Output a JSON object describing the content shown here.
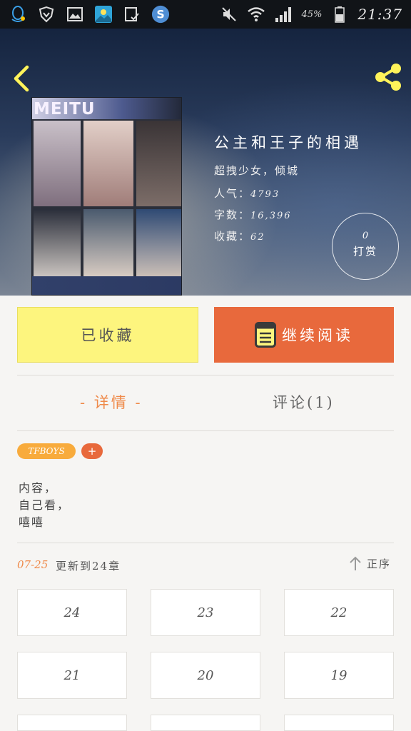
{
  "status_bar": {
    "battery_percent": "45%",
    "time": "21:37",
    "left_icons": [
      "qq-icon",
      "shield-icon",
      "gallery-icon",
      "scenery-app-icon",
      "check-icon",
      "s-app-icon"
    ],
    "right_icons": [
      "mute-icon",
      "wifi-icon",
      "signal-icon",
      "battery-icon"
    ]
  },
  "header": {
    "book_title": "公主和王子的相遇",
    "author": "超拽少女，倾城",
    "popularity": {
      "label": "人气：",
      "value": "4793"
    },
    "words": {
      "label": "字数：",
      "value": "16,396"
    },
    "favorites": {
      "label": "收藏：",
      "value": "62"
    },
    "reward": {
      "count": "0",
      "label": "打赏"
    },
    "cover_word": "MEITU"
  },
  "actions": {
    "collected_label": "已收藏",
    "continue_label": "继续阅读"
  },
  "tabs": {
    "details_label": "- 详情 -",
    "comments_label": "评论(1)"
  },
  "tags": {
    "items": [
      "TFBOYS"
    ],
    "add_label": "+"
  },
  "description": {
    "lines": [
      "内容，",
      "自己看，",
      "嘻嘻"
    ]
  },
  "update": {
    "date": "07-25",
    "text": "更新到24章",
    "sort_label": "正序"
  },
  "chapters": [
    "24",
    "23",
    "22",
    "21",
    "20",
    "19",
    "",
    "",
    ""
  ],
  "colors": {
    "accent_orange": "#e8693c",
    "collected_yellow": "#fdf57e",
    "tag_orange": "#f8ab3c",
    "tab_active": "#ef8a4a"
  }
}
